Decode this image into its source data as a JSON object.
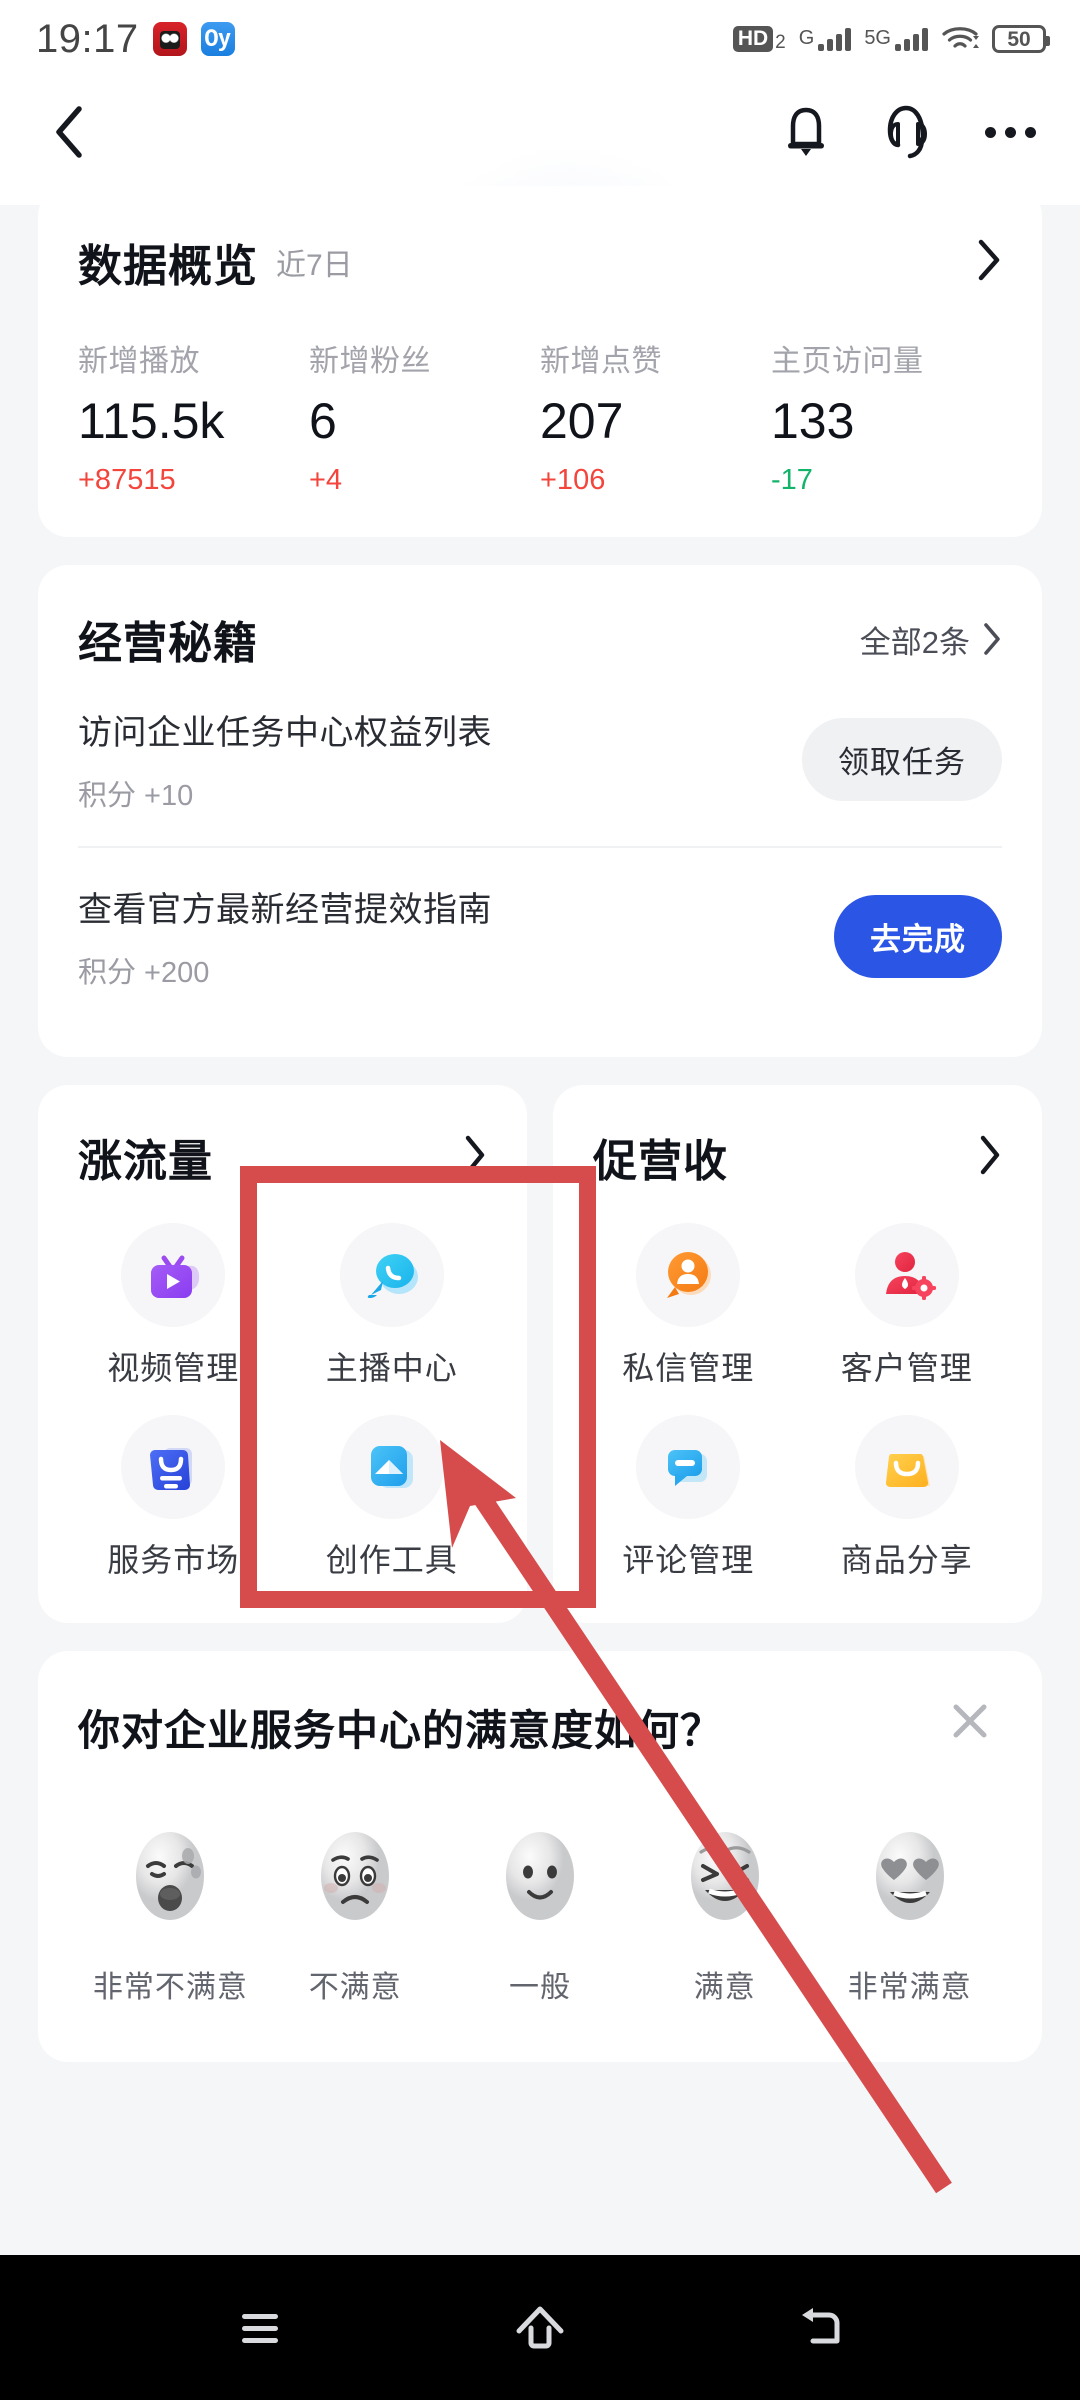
{
  "status_bar": {
    "time": "19:17",
    "app_icons": [
      "red-app-icon",
      "blue-app-icon"
    ],
    "hd_label": "HD",
    "hd_sub": "2",
    "sim1_label": "G",
    "sim2_label": "5G",
    "wifi": "wifi-icon",
    "battery_level": "50"
  },
  "app_bar": {
    "back": "back-chevron-icon",
    "notifications": "bell-icon",
    "support": "headset-icon",
    "more": "more-dots-icon"
  },
  "overview": {
    "title": "数据概览",
    "subtitle": "近7日",
    "arrow": "chevron-right-icon",
    "stats": [
      {
        "label": "新增播放",
        "value": "115.5k",
        "delta": "+87515",
        "trend": "up"
      },
      {
        "label": "新增粉丝",
        "value": "6",
        "delta": "+4",
        "trend": "up"
      },
      {
        "label": "新增点赞",
        "value": "207",
        "delta": "+106",
        "trend": "up"
      },
      {
        "label": "主页访问量",
        "value": "133",
        "delta": "-17",
        "trend": "down"
      }
    ]
  },
  "tips": {
    "title": "经营秘籍",
    "all_label": "全部2条",
    "items": [
      {
        "title": "访问企业任务中心权益列表",
        "points": "积分 +10",
        "button": "领取任务",
        "style": "grey"
      },
      {
        "title": "查看官方最新经营提效指南",
        "points": "积分 +200",
        "button": "去完成",
        "style": "blue"
      }
    ]
  },
  "panels": [
    {
      "title": "涨流量",
      "arrow": "chevron-right-icon",
      "tiles": [
        {
          "label": "视频管理",
          "icon": "tv-play-icon"
        },
        {
          "label": "主播中心",
          "icon": "speech-bubble-icon"
        },
        {
          "label": "服务市场",
          "icon": "service-bag-icon"
        },
        {
          "label": "创作工具",
          "icon": "creation-tool-icon"
        }
      ]
    },
    {
      "title": "促营收",
      "arrow": "chevron-right-icon",
      "tiles": [
        {
          "label": "私信管理",
          "icon": "message-person-icon"
        },
        {
          "label": "客户管理",
          "icon": "customer-gear-icon"
        },
        {
          "label": "评论管理",
          "icon": "comment-icon"
        },
        {
          "label": "商品分享",
          "icon": "shopping-bag-icon"
        }
      ]
    }
  ],
  "survey": {
    "question": "你对企业服务中心的满意度如何？",
    "close": "close-icon",
    "options": [
      {
        "label": "非常不满意",
        "face": "angry-face"
      },
      {
        "label": "不满意",
        "face": "sad-face"
      },
      {
        "label": "一般",
        "face": "neutral-face"
      },
      {
        "label": "满意",
        "face": "happy-face"
      },
      {
        "label": "非常满意",
        "face": "heart-eyes-face"
      }
    ]
  },
  "nav_bar": {
    "recents": "menu-icon",
    "home": "home-icon",
    "back": "back-arrow-icon"
  },
  "annotation": {
    "highlight_color": "#d64b4b",
    "target": "主播中心"
  },
  "colors": {
    "accent_blue": "#2a55e5",
    "up": "#f4453c",
    "down": "#13b36a",
    "page_bg": "#f5f6f8",
    "card_bg": "#ffffff"
  }
}
